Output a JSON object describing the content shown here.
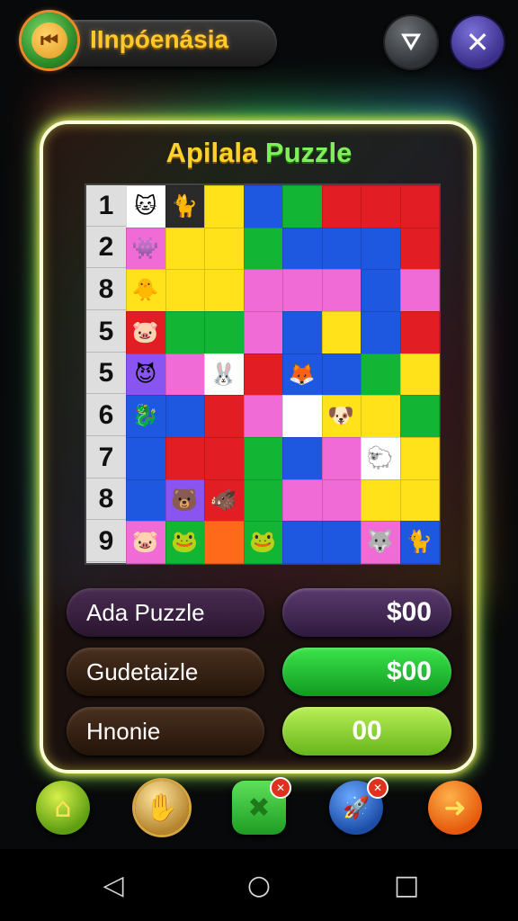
{
  "header": {
    "app_title": "IInpóenásia",
    "back_icon": "skip-back-icon",
    "filter_icon": "filter-icon",
    "close_icon": "close-icon",
    "back_glyph": "⏮",
    "filter_glyph": "⛛",
    "close_glyph": "✕"
  },
  "panel": {
    "title_part1": "Apilala",
    "title_part2": "Puzzle"
  },
  "board": {
    "row_labels": [
      "1",
      "2",
      "8",
      "5",
      "5",
      "6",
      "7",
      "8",
      "9"
    ]
  },
  "stats": [
    {
      "label": "Ada Puzzle",
      "value": "$00"
    },
    {
      "label": "Gudetaizle",
      "value": "$00"
    },
    {
      "label": "Hnonie",
      "value": "00"
    }
  ],
  "colors": {
    "accent_gold": "#ffc92a",
    "accent_green": "#7ff05a",
    "panel_glow": "#ffd94a"
  },
  "bottom_buttons": [
    {
      "icon": "house-icon",
      "glyph": "⌂"
    },
    {
      "icon": "coin-icon",
      "glyph": "✋"
    },
    {
      "icon": "remove-piece-icon",
      "glyph": "✖"
    },
    {
      "icon": "rocket-icon",
      "glyph": "🚀"
    },
    {
      "icon": "arrow-right-icon",
      "glyph": "➜"
    }
  ],
  "system_nav": {
    "back_glyph": "◁",
    "home_glyph": "○",
    "recent_glyph": "□"
  }
}
